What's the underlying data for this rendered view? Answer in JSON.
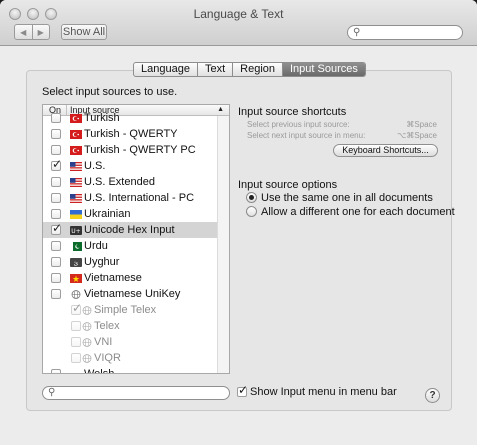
{
  "window": {
    "title": "Language & Text"
  },
  "toolbar": {
    "show_all_label": "Show All",
    "back": "◀",
    "forward": "▶"
  },
  "tabs": [
    {
      "label": "Language",
      "active": false
    },
    {
      "label": "Text",
      "active": false
    },
    {
      "label": "Region",
      "active": false
    },
    {
      "label": "Input Sources",
      "active": true
    }
  ],
  "instruction": "Select input sources to use.",
  "table": {
    "col_on": "On",
    "col_source": "Input source",
    "rows": [
      {
        "label": "Turkish",
        "checked": false,
        "flag": "tr",
        "partial": true
      },
      {
        "label": "Turkish - QWERTY",
        "checked": false,
        "flag": "tr"
      },
      {
        "label": "Turkish - QWERTY PC",
        "checked": false,
        "flag": "tr"
      },
      {
        "label": "U.S.",
        "checked": true,
        "flag": "us"
      },
      {
        "label": "U.S. Extended",
        "checked": false,
        "flag": "us"
      },
      {
        "label": "U.S. International - PC",
        "checked": false,
        "flag": "us"
      },
      {
        "label": "Ukrainian",
        "checked": false,
        "flag": "ua"
      },
      {
        "label": "Unicode Hex Input",
        "checked": true,
        "flag": "hex",
        "selected": true
      },
      {
        "label": "Urdu",
        "checked": false,
        "flag": "pk"
      },
      {
        "label": "Uyghur",
        "checked": false,
        "flag": "ug"
      },
      {
        "label": "Vietnamese",
        "checked": false,
        "flag": "vn"
      },
      {
        "label": "Vietnamese UniKey",
        "checked": false,
        "flag": "globe"
      },
      {
        "label": "Simple Telex",
        "checked": true,
        "flag": "globe",
        "sub": true
      },
      {
        "label": "Telex",
        "checked": false,
        "flag": "globe",
        "sub": true
      },
      {
        "label": "VNI",
        "checked": false,
        "flag": "globe",
        "sub": true
      },
      {
        "label": "VIQR",
        "checked": false,
        "flag": "globe",
        "sub": true
      },
      {
        "label": "Welsh",
        "checked": false,
        "flag": "wales"
      }
    ]
  },
  "shortcuts": {
    "heading": "Input source shortcuts",
    "prev_label": "Select previous input source:",
    "prev_key": "⌘Space",
    "next_label": "Select next input source in menu:",
    "next_key": "⌥⌘Space",
    "button_label": "Keyboard Shortcuts..."
  },
  "options": {
    "heading": "Input source options",
    "same_label": "Use the same one in all documents",
    "different_label": "Allow a different one for each document",
    "selected": "same"
  },
  "footer": {
    "show_menu_label": "Show Input menu in menu bar",
    "show_menu_checked": true,
    "help_label": "?"
  },
  "colors": {
    "selection": "#d4d4d4",
    "active_tab": "#7a7a7a"
  }
}
